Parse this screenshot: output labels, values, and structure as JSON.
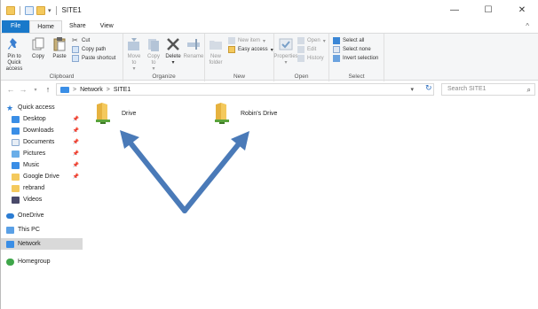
{
  "window": {
    "title": "SITE1",
    "minimize": "—",
    "maximize": "☐",
    "close": "✕"
  },
  "tabs": [
    {
      "label": "File"
    },
    {
      "label": "Home"
    },
    {
      "label": "Share"
    },
    {
      "label": "View"
    }
  ],
  "ribbon": {
    "clipboard": {
      "label": "Clipboard",
      "pin": "Pin to Quick access",
      "copy": "Copy",
      "paste": "Paste",
      "cut": "Cut",
      "copy_path": "Copy path",
      "paste_shortcut": "Paste shortcut"
    },
    "organize": {
      "label": "Organize",
      "move_to": "Move to",
      "copy_to": "Copy to",
      "delete": "Delete",
      "rename": "Rename"
    },
    "new": {
      "label": "New",
      "new_folder": "New folder",
      "new_item": "New item",
      "easy_access": "Easy access"
    },
    "open": {
      "label": "Open",
      "properties": "Properties",
      "open": "Open",
      "edit": "Edit",
      "history": "History"
    },
    "select": {
      "label": "Select",
      "select_all": "Select all",
      "select_none": "Select none",
      "invert": "Invert selection"
    }
  },
  "address": {
    "crumbs": [
      "Network",
      "SITE1"
    ],
    "separator": ">",
    "search_placeholder": "Search SITE1"
  },
  "nav": {
    "items": [
      {
        "label": "Quick access",
        "icon": "star-icon",
        "pinned": false
      },
      {
        "label": "Desktop",
        "icon": "desktop-folder-icon",
        "pinned": true
      },
      {
        "label": "Downloads",
        "icon": "downloads-folder-icon",
        "pinned": true
      },
      {
        "label": "Documents",
        "icon": "documents-folder-icon",
        "pinned": true
      },
      {
        "label": "Pictures",
        "icon": "pictures-folder-icon",
        "pinned": true
      },
      {
        "label": "Music",
        "icon": "music-folder-icon",
        "pinned": true
      },
      {
        "label": "Google Drive",
        "icon": "folder-icon",
        "pinned": true
      },
      {
        "label": "rebrand",
        "icon": "folder-icon",
        "pinned": false
      },
      {
        "label": "Videos",
        "icon": "videos-folder-icon",
        "pinned": false
      },
      {
        "label": "OneDrive",
        "icon": "cloud-icon",
        "pinned": false
      },
      {
        "label": "This PC",
        "icon": "computer-icon",
        "pinned": false
      },
      {
        "label": "Network",
        "icon": "network-icon",
        "pinned": false
      },
      {
        "label": "Homegroup",
        "icon": "homegroup-icon",
        "pinned": false
      }
    ],
    "selected": "Network"
  },
  "content": {
    "items": [
      {
        "label": "Drive",
        "icon": "network-share-icon"
      },
      {
        "label": "Robin's Drive",
        "icon": "network-share-icon"
      }
    ]
  },
  "colors": {
    "accent": "#1979ca",
    "arrow": "#4a7ab8",
    "folder": "#f4c95d",
    "share_green": "#5aa33a"
  }
}
